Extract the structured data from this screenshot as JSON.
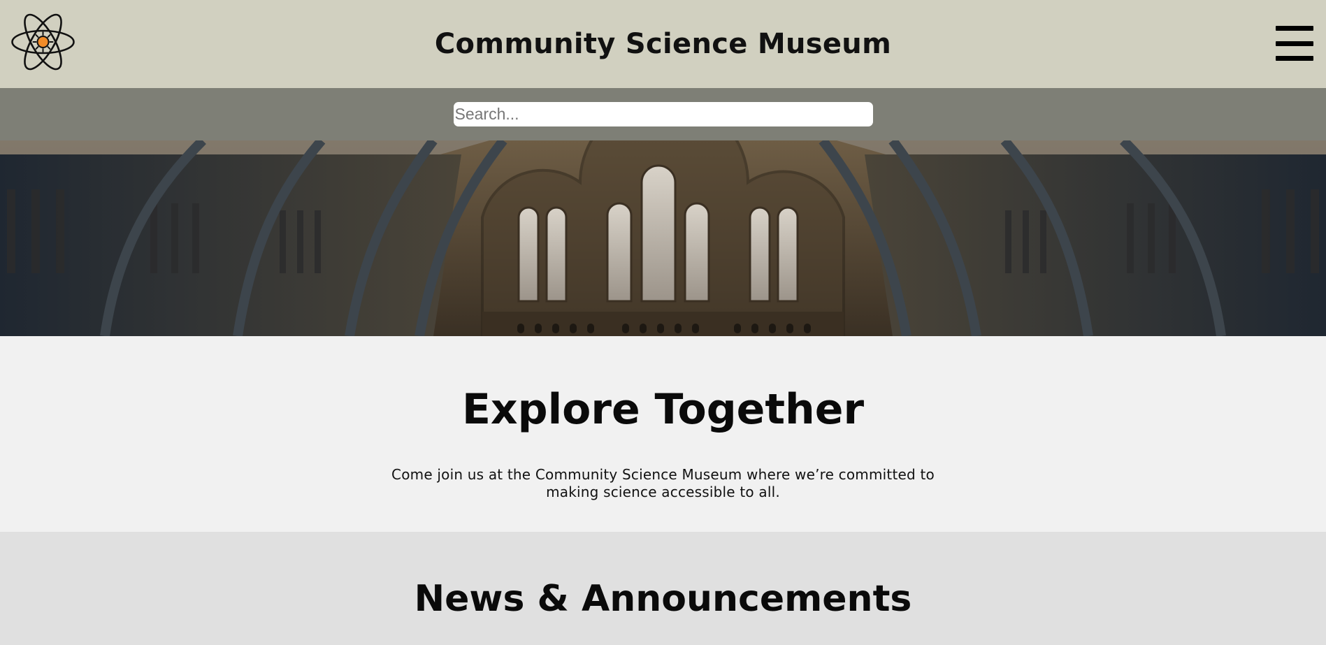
{
  "header": {
    "title": "Community Science Museum",
    "logo_icon": "atom-sun-icon",
    "menu_icon": "hamburger-menu-icon"
  },
  "search": {
    "placeholder": "Search...",
    "value": ""
  },
  "hero": {
    "image": "museum-hall-arched-windows"
  },
  "intro": {
    "heading": "Explore Together",
    "text": "Come join us at the Community Science Museum where we’re committed to making science accessible to all."
  },
  "news": {
    "heading": "News & Announcements"
  },
  "colors": {
    "header_bg": "#d1d0c0",
    "search_bar_bg": "#7e7f76",
    "intro_bg": "#f1f1f1",
    "news_bg": "#e0e0e0",
    "logo_accent": "#f28c28"
  }
}
